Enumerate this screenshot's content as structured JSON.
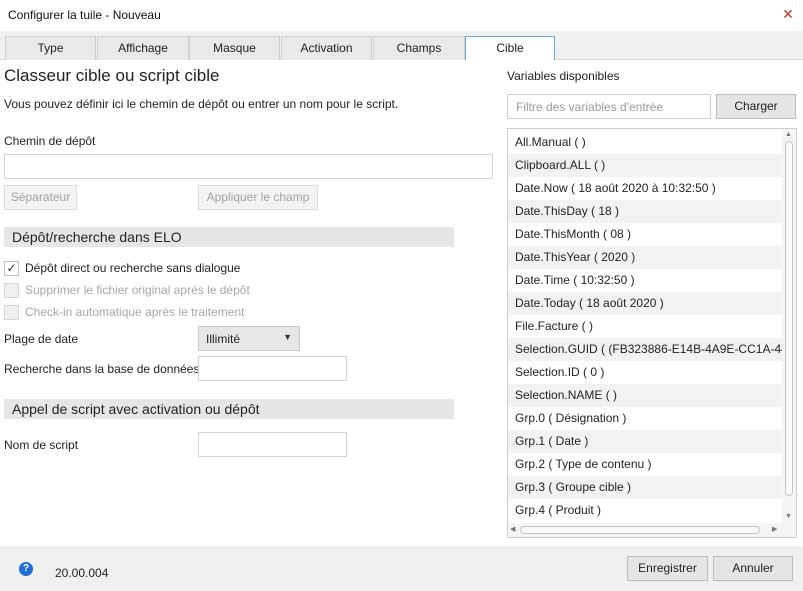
{
  "window": {
    "title": "Configurer la tuile - Nouveau"
  },
  "tabs": [
    {
      "label": "Type"
    },
    {
      "label": "Affichage"
    },
    {
      "label": "Masque"
    },
    {
      "label": "Activation"
    },
    {
      "label": "Champs"
    },
    {
      "label": "Cible",
      "active": true
    }
  ],
  "main": {
    "heading": "Classeur cible ou script cible",
    "description": "Vous pouvez définir ici le chemin de dépôt ou entrer un nom pour le script.",
    "path_label": "Chemin de dépôt",
    "path_value": "",
    "separator_button": "Séparateur",
    "apply_field_button": "Appliquer le champ",
    "section_elo": "Dépôt/recherche dans ELO",
    "checkboxes": [
      {
        "label": "Dépôt direct ou recherche sans dialogue",
        "checked": true,
        "disabled": false
      },
      {
        "label": "Supprimer le fichier original après le dépôt",
        "checked": false,
        "disabled": true
      },
      {
        "label": "Check-in automatique après le traitement",
        "checked": false,
        "disabled": true
      }
    ],
    "date_range_label": "Plage de date",
    "date_range_value": "Illimité",
    "db_search_label": "Recherche dans la base de données",
    "db_search_value": "",
    "section_script": "Appel de script avec activation ou dépôt",
    "script_name_label": "Nom de script",
    "script_name_value": ""
  },
  "variables": {
    "title": "Variables disponibles",
    "filter_placeholder": "Filtre des variables d'entrée",
    "load_button": "Charger",
    "items": [
      "All.Manual ( )",
      "Clipboard.ALL ( )",
      "Date.Now ( 18 août 2020 à 10:32:50 )",
      "Date.ThisDay ( 18 )",
      "Date.ThisMonth ( 08 )",
      "Date.ThisYear ( 2020 )",
      "Date.Time ( 10:32:50 )",
      "Date.Today ( 18 août 2020 )",
      "File.Facture ( )",
      "Selection.GUID ( (FB323886-E14B-4A9E-CC1A-44",
      "Selection.ID ( 0 )",
      "Selection.NAME ( )",
      "Grp.0 ( Désignation )",
      "Grp.1 ( Date )",
      "Grp.2 ( Type de contenu )",
      "Grp.3 ( Groupe cible )",
      "Grp.4 ( Produit )"
    ]
  },
  "footer": {
    "version": "20.00.004",
    "save_button": "Enregistrer",
    "cancel_button": "Annuler"
  },
  "icons": {
    "close": "close-icon",
    "help": "help-icon",
    "dropdown": "chevron-down-icon",
    "check": "check-icon"
  }
}
